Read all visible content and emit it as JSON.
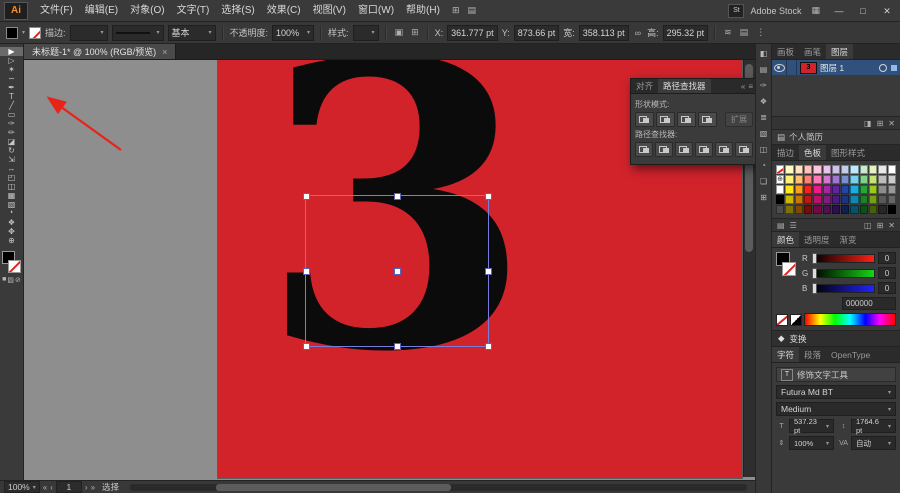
{
  "titlebar": {
    "logo": "Ai",
    "menus": [
      "文件(F)",
      "编辑(E)",
      "对象(O)",
      "文字(T)",
      "选择(S)",
      "效果(C)",
      "视图(V)",
      "窗口(W)",
      "帮助(H)"
    ],
    "menubar_icons": [
      "⊞",
      "▤"
    ],
    "stock_icon": "St",
    "stock_label": "Adobe Stock",
    "workspace_icon": "▦",
    "win_min": "—",
    "win_max": "□",
    "win_close": "✕"
  },
  "control_bar": {
    "stroke_label": "描边:",
    "brush_def": "基本",
    "opacity_label": "不透明度:",
    "opacity_value": "100%",
    "style_label": "样式:",
    "x_label": "X:",
    "x_value": "361.777 pt",
    "y_label": "Y:",
    "y_value": "873.66 pt",
    "w_label": "宽:",
    "w_value": "358.113 pt",
    "link_icon": "∞",
    "h_label": "高:",
    "h_value": "295.32 pt",
    "extra_icons": [
      "≋",
      "▤",
      "⋮"
    ]
  },
  "doc_tab": {
    "title": "未标题-1* @ 100% (RGB/预览)",
    "close": "×"
  },
  "toolbar": {
    "tools": [
      {
        "name": "selection-tool",
        "glyph": "▶",
        "active": true
      },
      {
        "name": "direct-selection-tool",
        "glyph": "▷",
        "active": false
      },
      {
        "name": "magic-wand-tool",
        "glyph": "✶",
        "active": false
      },
      {
        "name": "lasso-tool",
        "glyph": "∽",
        "active": false
      },
      {
        "name": "pen-tool",
        "glyph": "✒",
        "active": false
      },
      {
        "name": "type-tool",
        "glyph": "T",
        "active": false
      },
      {
        "name": "line-segment-tool",
        "glyph": "╱",
        "active": false
      },
      {
        "name": "rectangle-tool",
        "glyph": "▭",
        "active": false
      },
      {
        "name": "paintbrush-tool",
        "glyph": "✑",
        "active": false
      },
      {
        "name": "pencil-tool",
        "glyph": "✏",
        "active": false
      },
      {
        "name": "eraser-tool",
        "glyph": "◪",
        "active": false
      },
      {
        "name": "rotate-tool",
        "glyph": "↻",
        "active": false
      },
      {
        "name": "scale-tool",
        "glyph": "⇲",
        "active": false
      },
      {
        "name": "width-tool",
        "glyph": "↔",
        "active": false
      },
      {
        "name": "free-transform-tool",
        "glyph": "◰",
        "active": false
      },
      {
        "name": "shape-builder-tool",
        "glyph": "◫",
        "active": false
      },
      {
        "name": "mesh-tool",
        "glyph": "▦",
        "active": false
      },
      {
        "name": "gradient-tool",
        "glyph": "▧",
        "active": false
      },
      {
        "name": "eyedropper-tool",
        "glyph": "❛",
        "active": false
      },
      {
        "name": "blend-tool",
        "glyph": "❖",
        "active": false
      },
      {
        "name": "hand-tool",
        "glyph": "✥",
        "active": false
      },
      {
        "name": "zoom-tool",
        "glyph": "⊕",
        "active": false
      }
    ],
    "mode_icons": [
      "■",
      "▨",
      "⊘"
    ]
  },
  "canvas": {
    "glyph": "3"
  },
  "pathfinder": {
    "tabs": [
      "对齐",
      "路径查找器"
    ],
    "collapse_icon": "«",
    "menu_icon": "≡",
    "sections": [
      {
        "label": "形状模式:",
        "buttons": [
          "联集",
          "减去顶层",
          "交集",
          "差集"
        ],
        "extra_button": "扩展"
      },
      {
        "label": "路径查找器:",
        "buttons": [
          "分割",
          "修边",
          "合并",
          "裁剪",
          "轮廓",
          "减去后方对象"
        ]
      }
    ]
  },
  "right_strip": {
    "icons": [
      {
        "name": "color-panel-icon",
        "glyph": "◧"
      },
      {
        "name": "swatches-panel-icon",
        "glyph": "▤"
      },
      {
        "name": "brushes-panel-icon",
        "glyph": "✑"
      },
      {
        "name": "symbols-panel-icon",
        "glyph": "❖"
      },
      {
        "name": "stroke-panel-icon",
        "glyph": "≣"
      },
      {
        "name": "gradient-panel-icon",
        "glyph": "▧"
      },
      {
        "name": "transparency-panel-icon",
        "glyph": "◫"
      },
      {
        "name": "appearance-panel-icon",
        "glyph": "◔"
      },
      {
        "name": "graphic-styles-panel-icon",
        "glyph": "❏"
      },
      {
        "name": "links-panel-icon",
        "glyph": "⊞"
      }
    ]
  },
  "dock": {
    "top_tabs": [
      "画板",
      "画笔",
      "图层"
    ],
    "layers": {
      "row_name": "图层 1",
      "thumb_glyph": "3",
      "foot_icons": [
        "◨",
        "⊞",
        "✕"
      ]
    },
    "library_bar": {
      "icon": "▤",
      "label": "个人简历"
    },
    "swatch_tabs": [
      "描边",
      "色板",
      "图形样式"
    ],
    "swatches_grid": [
      [
        "none",
        "#fff9c2",
        "#ffe3c2",
        "#ffc2bd",
        "#ffc2dd",
        "#eac2ea",
        "#cfc2ea",
        "#c2cdea",
        "#c2e9f7",
        "#c6eccb",
        "#e4f2c2",
        "#e8e8e8",
        "#ffffff"
      ],
      [
        "reg",
        "#fff173",
        "#ffc173",
        "#ff8078",
        "#ff78b5",
        "#d078d0",
        "#9e78d0",
        "#788fd0",
        "#78d2ed",
        "#7ed489",
        "#c6e378",
        "#bdbdbd",
        "#cccccc"
      ],
      [
        "#ffffff",
        "#ffe81a",
        "#ff9e1a",
        "#f2231e",
        "#f2188c",
        "#a823a8",
        "#6023a8",
        "#2344a8",
        "#1aaede",
        "#23a833",
        "#97cc1a",
        "#8c8c8c",
        "#999999"
      ],
      [
        "#000000",
        "#ccb700",
        "#cc7700",
        "#bf1713",
        "#bf0f6d",
        "#821b82",
        "#4a1b82",
        "#1b3482",
        "#1486ab",
        "#1b8227",
        "#76a114",
        "#595959",
        "#666666"
      ],
      [
        "#4d4d4d",
        "#7f7200",
        "#7f4a00",
        "#730e0b",
        "#730942",
        "#4e104e",
        "#2c104e",
        "#101f4e",
        "#0c5066",
        "#104e17",
        "#46610c",
        "#262626",
        "#000000"
      ]
    ],
    "swatch_foot_left": [
      "▤",
      "☰"
    ],
    "swatch_foot_right": [
      "◫",
      "⊞",
      "✕"
    ],
    "color_tabs": [
      "颜色",
      "透明度",
      "渐变"
    ],
    "channels": [
      {
        "label": "R",
        "value": "0",
        "color": "#ff2018"
      },
      {
        "label": "G",
        "value": "0",
        "color": "#17d417"
      },
      {
        "label": "B",
        "value": "0",
        "color": "#2222ff"
      }
    ],
    "hex": "000000",
    "transform": {
      "icon": "◆",
      "label": "变换"
    },
    "char_tabs": [
      "字符",
      "段落",
      "OpenType"
    ],
    "character": {
      "icons": {
        "touch": "T",
        "size": "T",
        "leading": "↕",
        "v_scale": "⇕",
        "kerning": "VA"
      },
      "touch_label": "修饰文字工具",
      "font": "Futura Md BT",
      "style": "Medium",
      "size": "537.23 pt",
      "leading": "1764.6 pt",
      "v_scale": "100%",
      "kerning": "自动"
    }
  },
  "status_bar": {
    "zoom": "100%",
    "nav": [
      "«",
      "‹",
      "›",
      "»"
    ],
    "artboard": "1",
    "tool": "选择"
  },
  "annotation": {
    "arrow_color": "#e82318"
  }
}
